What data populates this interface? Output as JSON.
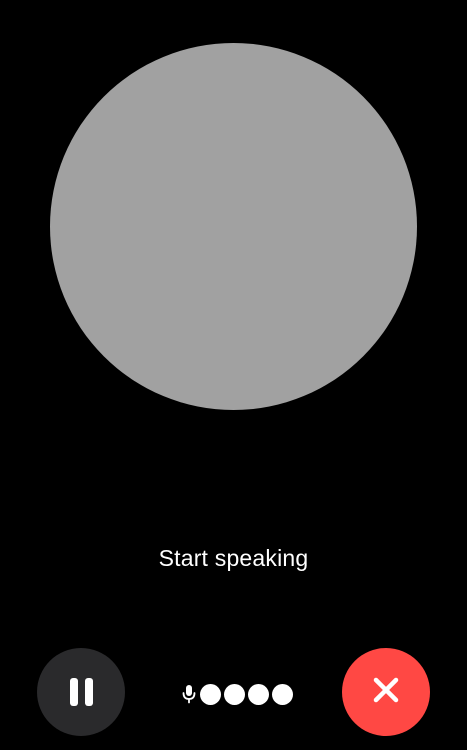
{
  "status": {
    "text": "Start speaking"
  },
  "controls": {
    "pause_icon": "pause-icon",
    "end_icon": "close-icon",
    "mic_icon": "microphone-icon",
    "level_dot_count": 4
  },
  "colors": {
    "background": "#000000",
    "orb": "#a1a1a1",
    "pause_button": "#2a2a2c",
    "end_button": "#ff4844",
    "foreground": "#ffffff"
  }
}
